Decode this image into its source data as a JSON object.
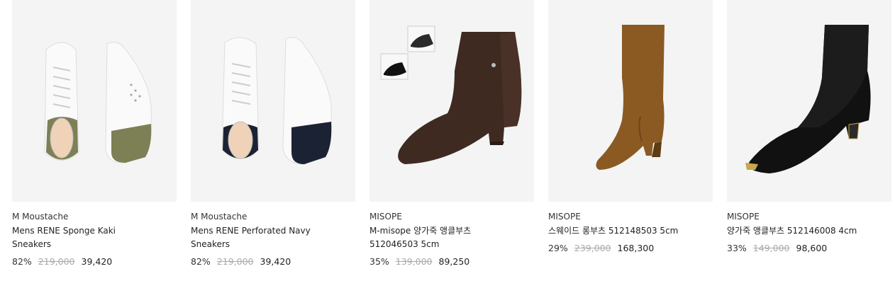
{
  "products": [
    {
      "brand": "M Moustache",
      "name": "Mens RENE Sponge Kaki Sneakers",
      "discount": "82%",
      "original_price": "219,000",
      "price": "39,420",
      "image_icon": "white-khaki-sneaker-pair-image",
      "accent": "#7d7f55"
    },
    {
      "brand": "M Moustache",
      "name": "Mens RENE Perforated Navy Sneakers",
      "discount": "82%",
      "original_price": "219,000",
      "price": "39,420",
      "image_icon": "white-navy-sneaker-pair-image",
      "accent": "#1b2233"
    },
    {
      "brand": "MISOPE",
      "name": "M-misope 양가죽 앵클부츠 512046503 5cm",
      "discount": "35%",
      "original_price": "139,000",
      "price": "89,250",
      "image_icon": "brown-ankle-boot-image",
      "accent": "#3f2a22"
    },
    {
      "brand": "MISOPE",
      "name": "스웨이드 롱부츠 512148503 5cm",
      "discount": "29%",
      "original_price": "239,000",
      "price": "168,300",
      "image_icon": "suede-long-boot-image",
      "accent": "#8a5a22"
    },
    {
      "brand": "MISOPE",
      "name": "양가죽 앵클부츠 512146008 4cm",
      "discount": "33%",
      "original_price": "149,000",
      "price": "98,600",
      "image_icon": "black-sock-ankle-boot-image",
      "accent": "#111111"
    }
  ]
}
